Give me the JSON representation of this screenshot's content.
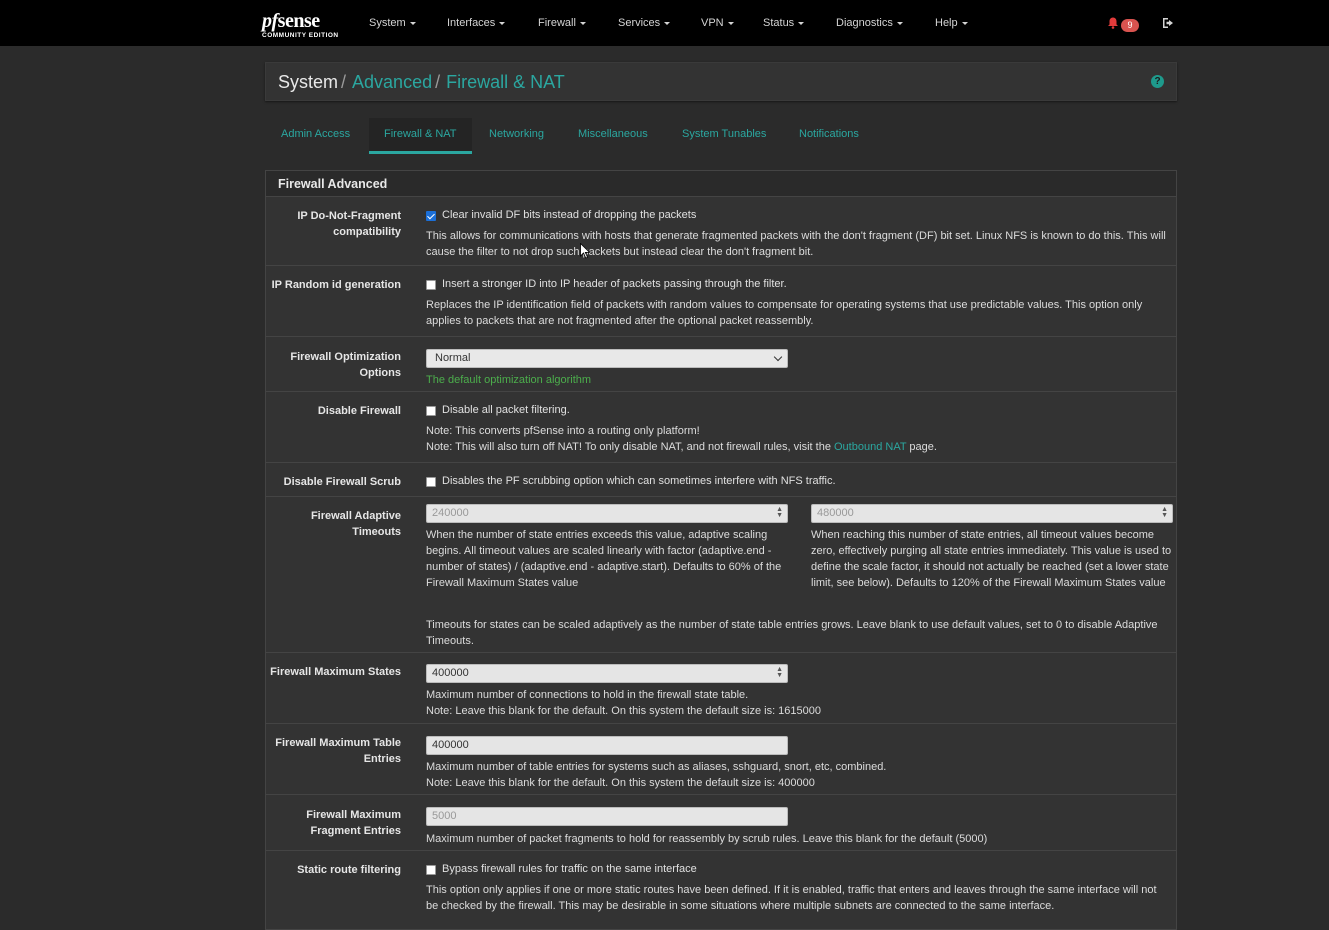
{
  "logo": {
    "brand_pf": "pf",
    "brand_sense": "sense",
    "edition": "COMMUNITY EDITION"
  },
  "nav": {
    "items": [
      "System",
      "Interfaces",
      "Firewall",
      "Services",
      "VPN",
      "Status",
      "Diagnostics",
      "Help"
    ],
    "notification_count": "9"
  },
  "breadcrumb": {
    "root": "System",
    "sep": "/",
    "level1": "Advanced",
    "level2": "Firewall & NAT"
  },
  "help_icon": "?",
  "tabs": [
    "Admin Access",
    "Firewall & NAT",
    "Networking",
    "Miscellaneous",
    "System Tunables",
    "Notifications"
  ],
  "active_tab": "Firewall & NAT",
  "panel": {
    "title": "Firewall Advanced"
  },
  "rows": {
    "df": {
      "label": "IP Do-Not-Fragment compatibility",
      "checkbox_label": "Clear invalid DF bits instead of dropping the packets",
      "checked": true,
      "help": "This allows for communications with hosts that generate fragmented packets with the don't fragment (DF) bit set. Linux NFS is known to do this. This will cause the filter to not drop such packets but instead clear the don't fragment bit."
    },
    "randid": {
      "label": "IP Random id generation",
      "checkbox_label": "Insert a stronger ID into IP header of packets passing through the filter.",
      "checked": false,
      "help": "Replaces the IP identification field of packets with random values to compensate for operating systems that use predictable values. This option only applies to packets that are not fragmented after the optional packet reassembly."
    },
    "optim": {
      "label": "Firewall Optimization Options",
      "value": "Normal",
      "help": "The default optimization algorithm"
    },
    "disable_fw": {
      "label": "Disable Firewall",
      "checkbox_label": "Disable all packet filtering.",
      "checked": false,
      "note1": "Note: This converts pfSense into a routing only platform!",
      "note2_pre": "Note: This will also turn off NAT! To only disable NAT, and not firewall rules, visit the",
      "note2_link": "Outbound NAT",
      "note2_post": "page."
    },
    "scrub": {
      "label": "Disable Firewall Scrub",
      "checkbox_label": "Disables the PF scrubbing option which can sometimes interfere with NFS traffic.",
      "checked": false
    },
    "adaptive": {
      "label": "Firewall Adaptive Timeouts",
      "start_placeholder": "240000",
      "end_placeholder": "480000",
      "start_help": "When the number of state entries exceeds this value, adaptive scaling begins. All timeout values are scaled linearly with factor (adaptive.end - number of states) / (adaptive.end - adaptive.start). Defaults to 60% of the Firewall Maximum States value",
      "end_help": "When reaching this number of state entries, all timeout values become zero, effectively purging all state entries immediately. This value is used to define the scale factor, it should not actually be reached (set a lower state limit, see below). Defaults to 120% of the Firewall Maximum States value",
      "help": "Timeouts for states can be scaled adaptively as the number of state table entries grows. Leave blank to use default values, set to 0 to disable Adaptive Timeouts."
    },
    "maxstates": {
      "label": "Firewall Maximum States",
      "value": "400000",
      "help1": "Maximum number of connections to hold in the firewall state table.",
      "help2": "Note: Leave this blank for the default. On this system the default size is: 1615000"
    },
    "maxtable": {
      "label": "Firewall Maximum Table Entries",
      "value": "400000",
      "help1": "Maximum number of table entries for systems such as aliases, sshguard, snort, etc, combined.",
      "help2": "Note: Leave this blank for the default. On this system the default size is: 400000"
    },
    "maxfrag": {
      "label": "Firewall Maximum Fragment Entries",
      "placeholder": "5000",
      "help": "Maximum number of packet fragments to hold for reassembly by scrub rules. Leave this blank for the default (5000)"
    },
    "staticroute": {
      "label": "Static route filtering",
      "checkbox_label": "Bypass firewall rules for traffic on the same interface",
      "checked": false,
      "help": "This option only applies if one or more static routes have been defined. If it is enabled, traffic that enters and leaves through the same interface will not be checked by the firewall. This may be desirable in some situations where multiple subnets are connected to the same interface."
    }
  }
}
